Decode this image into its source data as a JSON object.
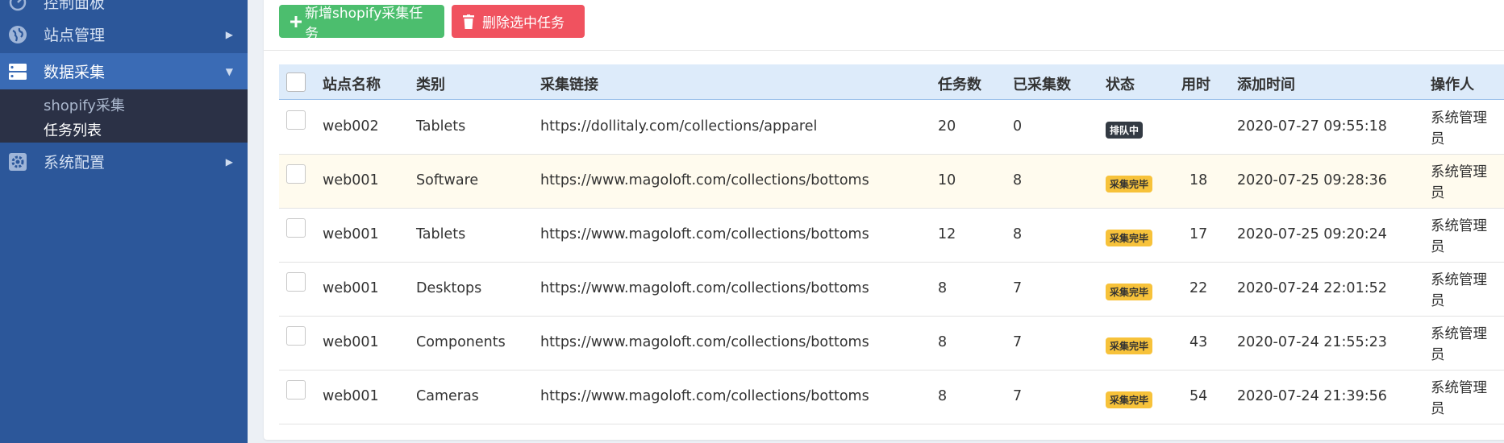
{
  "sidebar": {
    "top_partial_label": "控制面板",
    "items": [
      {
        "label": "站点管理"
      },
      {
        "label": "数据采集"
      },
      {
        "label": "系统配置"
      }
    ],
    "submenu": [
      "shopify采集",
      "任务列表"
    ]
  },
  "toolbar": {
    "add_label": "新增shopify采集任务",
    "delete_label": "删除选中任务"
  },
  "table": {
    "headers": [
      "站点名称",
      "类别",
      "采集链接",
      "任务数",
      "已采集数",
      "状态",
      "用时",
      "添加时间",
      "操作人"
    ],
    "rows": [
      {
        "site": "web002",
        "category": "Tablets",
        "url": "https://dollitaly.com/collections/apparel",
        "tasks": "20",
        "collected": "0",
        "status": "排队中",
        "status_type": "queue",
        "duration": "",
        "added": "2020-07-27 09:55:18",
        "operator": "系统管理员"
      },
      {
        "site": "web001",
        "category": "Software",
        "url": "https://www.magoloft.com/collections/bottoms",
        "tasks": "10",
        "collected": "8",
        "status": "采集完毕",
        "status_type": "done",
        "duration": "18",
        "added": "2020-07-25 09:28:36",
        "operator": "系统管理员"
      },
      {
        "site": "web001",
        "category": "Tablets",
        "url": "https://www.magoloft.com/collections/bottoms",
        "tasks": "12",
        "collected": "8",
        "status": "采集完毕",
        "status_type": "done",
        "duration": "17",
        "added": "2020-07-25 09:20:24",
        "operator": "系统管理员"
      },
      {
        "site": "web001",
        "category": "Desktops",
        "url": "https://www.magoloft.com/collections/bottoms",
        "tasks": "8",
        "collected": "7",
        "status": "采集完毕",
        "status_type": "done",
        "duration": "22",
        "added": "2020-07-24 22:01:52",
        "operator": "系统管理员"
      },
      {
        "site": "web001",
        "category": "Components",
        "url": "https://www.magoloft.com/collections/bottoms",
        "tasks": "8",
        "collected": "7",
        "status": "采集完毕",
        "status_type": "done",
        "duration": "43",
        "added": "2020-07-24 21:55:23",
        "operator": "系统管理员"
      },
      {
        "site": "web001",
        "category": "Cameras",
        "url": "https://www.magoloft.com/collections/bottoms",
        "tasks": "8",
        "collected": "7",
        "status": "采集完毕",
        "status_type": "done",
        "duration": "54",
        "added": "2020-07-24 21:39:56",
        "operator": "系统管理员"
      }
    ]
  },
  "colors": {
    "sidebar_bg": "#2c579a",
    "sidebar_active": "#3a6bb5",
    "submenu_bg": "#2b3146",
    "add_button": "#4cbe6e",
    "delete_button": "#f0525f",
    "header_bg": "#ddebfa",
    "highlight_row": "#fffbee",
    "badge_queue": "#333a43",
    "badge_done": "#f7c23a"
  },
  "icons": {
    "dashboard": "dashboard-icon",
    "sites": "globe-icon",
    "data": "server-icon",
    "config": "gear-icon",
    "add": "plus-icon",
    "delete": "trash-icon"
  }
}
